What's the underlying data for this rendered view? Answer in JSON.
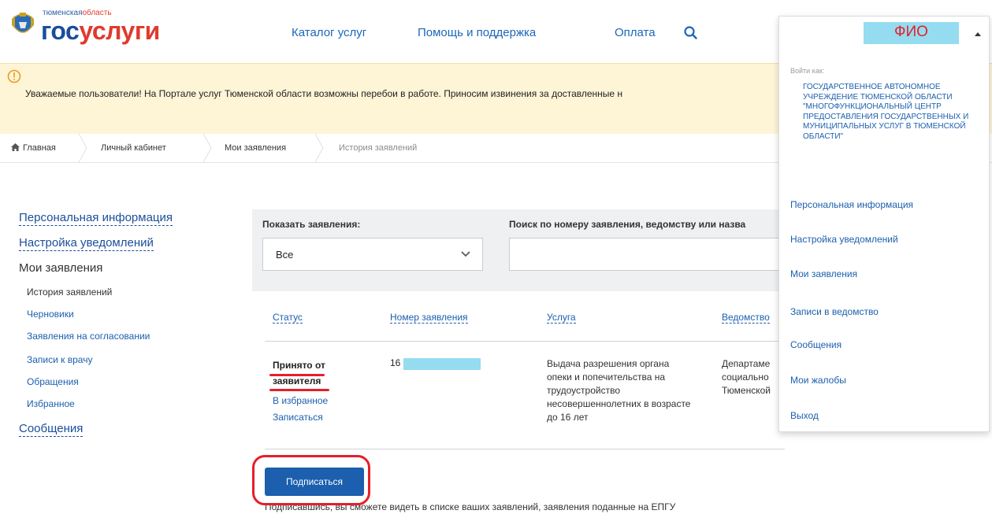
{
  "header": {
    "logo_region_a": "тюменская",
    "logo_region_b": "область",
    "logo_brand_a": "гос",
    "logo_brand_b": "услуги",
    "nav": [
      "Каталог услуг",
      "Помощь и поддержка",
      "Оплата"
    ]
  },
  "banner": {
    "text": "Уважаемые пользователи! На Портале услуг Тюменской области возможны перебои в работе. Приносим извинения за доставленные н"
  },
  "breadcrumb": [
    "Главная",
    "Личный кабинет",
    "Мои заявления",
    "История заявлений"
  ],
  "sidebar": {
    "personal": "Персональная информация",
    "notifications": "Настройка уведомлений",
    "my_applications": "Мои заявления",
    "sub": [
      "История заявлений",
      "Черновики",
      "Заявления на согласовании",
      "Записи к врачу",
      "Обращения",
      "Избранное"
    ],
    "messages": "Сообщения"
  },
  "filter": {
    "show_label": "Показать заявления:",
    "show_value": "Все",
    "search_label": "Поиск по номеру заявления, ведомству или назва"
  },
  "table": {
    "headers": [
      "Статус",
      "Номер заявления",
      "Услуга",
      "Ведомство"
    ],
    "row": {
      "status_line1": "Принято от",
      "status_line2": "заявителя",
      "favorite": "В избранное",
      "signup": "Записаться",
      "number": "16",
      "service": "Выдача разрешения органа опеки и попечительства на трудоустройство несовершеннолетних в возрасте до 16 лет",
      "agency": [
        "Департаме",
        "социально",
        "Тюменской"
      ]
    }
  },
  "subscribe": {
    "button": "Подписаться",
    "hint": "Подписавшись, вы сможете видеть в списке ваших заявлений, заявления поданные на ЕПГУ"
  },
  "dropdown": {
    "user": "ФИО",
    "login_as": "Войти как:",
    "org": "ГОСУДАРСТВЕННОЕ АВТОНОМНОЕ УЧРЕЖДЕНИЕ ТЮМЕНСКОЙ ОБЛАСТИ \"МНОГОФУНКЦИОНАЛЬНЫЙ ЦЕНТР ПРЕДОСТАВЛЕНИЯ ГОСУДАРСТВЕННЫХ И МУНИЦИПАЛЬНЫХ УСЛУГ В ТЮМЕНСКОЙ ОБЛАСТИ\"",
    "items": [
      "Персональная информация",
      "Настройка уведомлений",
      "Мои заявления",
      "Записи в ведомство",
      "Сообщения",
      "Мои жалобы",
      "Выход"
    ]
  },
  "colors": {
    "brand_blue": "#1b4e9b",
    "brand_red": "#e03a2e",
    "link_blue": "#1b5fae",
    "banner_bg": "#fef4d6",
    "redaction": "#95dcf0",
    "annotation_red": "#e3202a"
  },
  "icons": [
    "coat-of-arms-icon",
    "search-icon",
    "warning-icon",
    "home-icon",
    "chevron-down-icon",
    "caret-up-icon"
  ]
}
